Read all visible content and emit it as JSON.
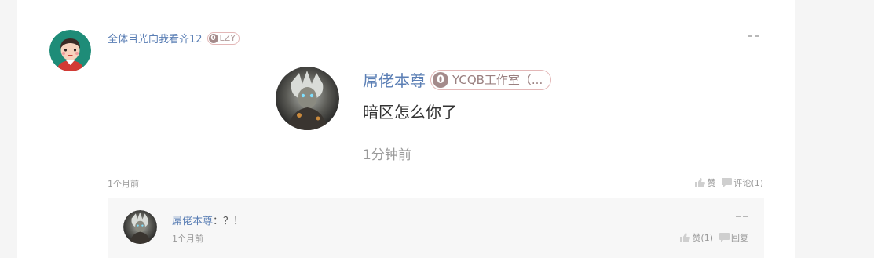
{
  "post": {
    "author": "全体目光向我看齐12",
    "badge_level": "0",
    "badge_text": "LZY",
    "time": "1个月前",
    "like_label": "赞",
    "comment_label": "评论(1)"
  },
  "card": {
    "name": "屌佬本尊",
    "badge_level": "0",
    "badge_text": "YCQB工作室（...",
    "text": "暗区怎么你了",
    "time": "1分钟前"
  },
  "reply": {
    "author": "屌佬本尊",
    "separator": "：",
    "text": "？！",
    "time": "1个月前",
    "like_label": "赞(1)",
    "reply_label": "回复"
  },
  "icons": {
    "more": "more-icon",
    "like": "thumbs-up-icon",
    "comment": "comment-icon"
  },
  "colors": {
    "link": "#5b7fb5",
    "muted": "#999999",
    "badge_border": "#e3b7b7"
  }
}
